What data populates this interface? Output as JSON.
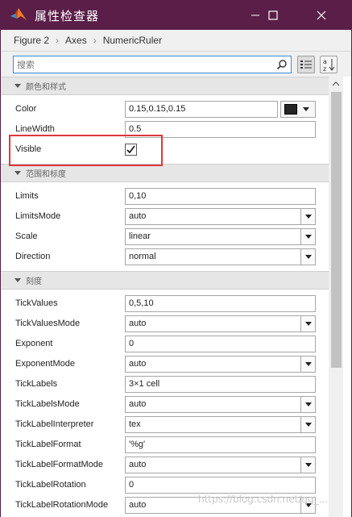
{
  "window": {
    "title": "属性检查器"
  },
  "breadcrumb": [
    "Figure 2",
    "Axes",
    "NumericRuler"
  ],
  "search": {
    "value": "搜索",
    "placeholder": "搜索"
  },
  "sections": {
    "color_style": "颜色和样式",
    "range_scale": "范围和标度",
    "ticks": "刻度"
  },
  "properties": {
    "color": {
      "label": "Color",
      "value": "0.15,0.15,0.15",
      "swatch": "#262626"
    },
    "linewidth": {
      "label": "LineWidth",
      "value": "0.5"
    },
    "visible": {
      "label": "Visible",
      "checked": true
    },
    "limits": {
      "label": "Limits",
      "value": "0,10"
    },
    "limitsmode": {
      "label": "LimitsMode",
      "value": "auto"
    },
    "scale": {
      "label": "Scale",
      "value": "linear"
    },
    "direction": {
      "label": "Direction",
      "value": "normal"
    },
    "tickvalues": {
      "label": "TickValues",
      "value": "0,5,10"
    },
    "tickvaluesmode": {
      "label": "TickValuesMode",
      "value": "auto"
    },
    "exponent": {
      "label": "Exponent",
      "value": "0"
    },
    "exponentmode": {
      "label": "ExponentMode",
      "value": "auto"
    },
    "ticklabels": {
      "label": "TickLabels",
      "value": "3×1 cell"
    },
    "ticklabelsmode": {
      "label": "TickLabelsMode",
      "value": "auto"
    },
    "ticklabelinterpreter": {
      "label": "TickLabelInterpreter",
      "value": "tex"
    },
    "ticklabelformat": {
      "label": "TickLabelFormat",
      "value": "'%g'"
    },
    "ticklabelformatmode": {
      "label": "TickLabelFormatMode",
      "value": "auto"
    },
    "ticklabelrotation": {
      "label": "TickLabelRotation",
      "value": "0"
    },
    "ticklabelrotationmode": {
      "label": "TickLabelRotationMode",
      "value": "auto"
    }
  },
  "watermark": "https://blog.csdn.net/qq_...",
  "colors": {
    "titlebar": "#5a1e48",
    "highlight": "#e0373b",
    "search_border": "#3c8dd9"
  }
}
